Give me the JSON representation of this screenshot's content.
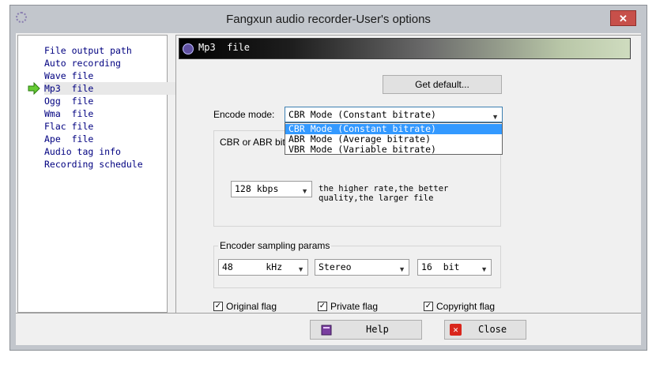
{
  "window": {
    "title": "Fangxun audio recorder-User's options",
    "close_glyph": "✕"
  },
  "nav": {
    "items": [
      {
        "label": "File output path"
      },
      {
        "label": "Auto recording"
      },
      {
        "label": "Wave file"
      },
      {
        "label": "Mp3  file",
        "selected": true
      },
      {
        "label": "Ogg  file"
      },
      {
        "label": "Wma  file"
      },
      {
        "label": "Flac file"
      },
      {
        "label": "Ape  file"
      },
      {
        "label": "Audio tag info"
      },
      {
        "label": "Recording schedule"
      }
    ]
  },
  "panel": {
    "header_title": "Mp3  file",
    "get_default_label": "Get default...",
    "encode_mode_label": "Encode mode:",
    "encode_mode_value": "CBR Mode (Constant bitrate)",
    "encode_mode_options": [
      "CBR Mode (Constant bitrate)",
      "ABR Mode (Average bitrate)",
      "VBR Mode (Variable bitrate)"
    ],
    "bitrate_group_label": "CBR or ABR bit",
    "bitrate_value": "128 kbps",
    "bitrate_hint_1": "the higher rate,the better",
    "bitrate_hint_2": "quality,the larger file",
    "sampling_group_label": "Encoder sampling params",
    "sample_rate_value": "48      kHz",
    "channels_value": "Stereo",
    "bit_depth_value": "16  bit",
    "flags": [
      {
        "label": "Original flag",
        "checked": true
      },
      {
        "label": "Private flag",
        "checked": true
      },
      {
        "label": "Copyright flag",
        "checked": true
      }
    ]
  },
  "footer": {
    "help_label": "Help",
    "close_label": "Close"
  },
  "colors": {
    "nav_text": "#000080",
    "selection": "#3399ff",
    "title_bar": "#c2c6cc",
    "close_button": "#c7504a"
  }
}
